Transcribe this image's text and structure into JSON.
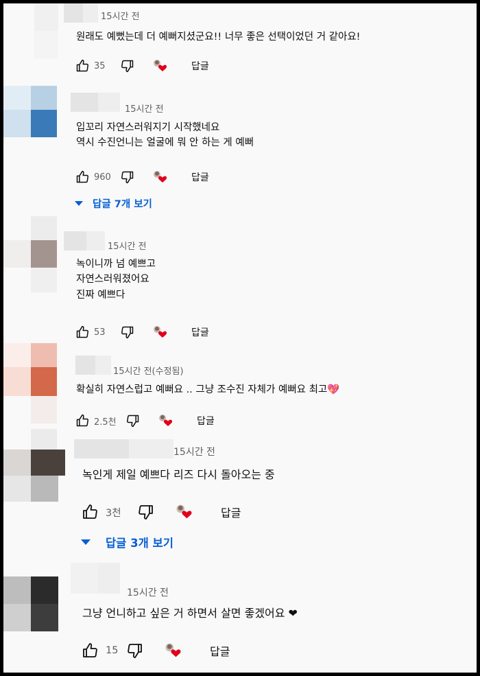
{
  "comments": [
    {
      "timestamp": "15시간 전",
      "lines": [
        "원래도 예뻤는데 더 예뻐지셨군요!! 너무 좋은 선택이었던 거 같아요!"
      ],
      "likes": "35",
      "reply_label": "답글"
    },
    {
      "timestamp": "15시간 전",
      "lines": [
        "입꼬리 자연스러워지기 시작했네요",
        " 역시 수진언니는 얼굴에 뭐 안 하는 게 예뻐"
      ],
      "likes": "960",
      "reply_label": "답글",
      "replies_toggle": "답글 7개 보기"
    },
    {
      "timestamp": "15시간 전",
      "lines": [
        "녹이니까 넘 예쁘고",
        "자연스러워졌어요",
        "진짜 예쁘다"
      ],
      "likes": "53",
      "reply_label": "답글"
    },
    {
      "timestamp": "15시간 전(수정됨)",
      "lines": [
        "확실히 자연스럽고 예뻐요 .. 그냥 조수진 자체가 예뻐요 최고💖"
      ],
      "likes": "2.5천",
      "reply_label": "답글"
    },
    {
      "timestamp": "15시간 전",
      "lines": [
        "녹인게 제일 예쁘다 리즈 다시 돌아오는 중"
      ],
      "likes": "3천",
      "reply_label": "답글",
      "replies_toggle": "답글 3개 보기"
    },
    {
      "timestamp": "15시간 전",
      "lines": [
        "그냥 언니하고 싶은 거 하면서 살면 좋겠어요 ❤"
      ],
      "likes": "15",
      "reply_label": "답글"
    }
  ],
  "colors": {
    "text": "#0f0f0f",
    "meta": "#606060",
    "link": "#065fd4",
    "heart": "#e0001b",
    "background": "#f9f9f9"
  },
  "icons": [
    "like-icon",
    "dislike-icon",
    "creator-heart-icon",
    "expand-triangle-icon"
  ]
}
